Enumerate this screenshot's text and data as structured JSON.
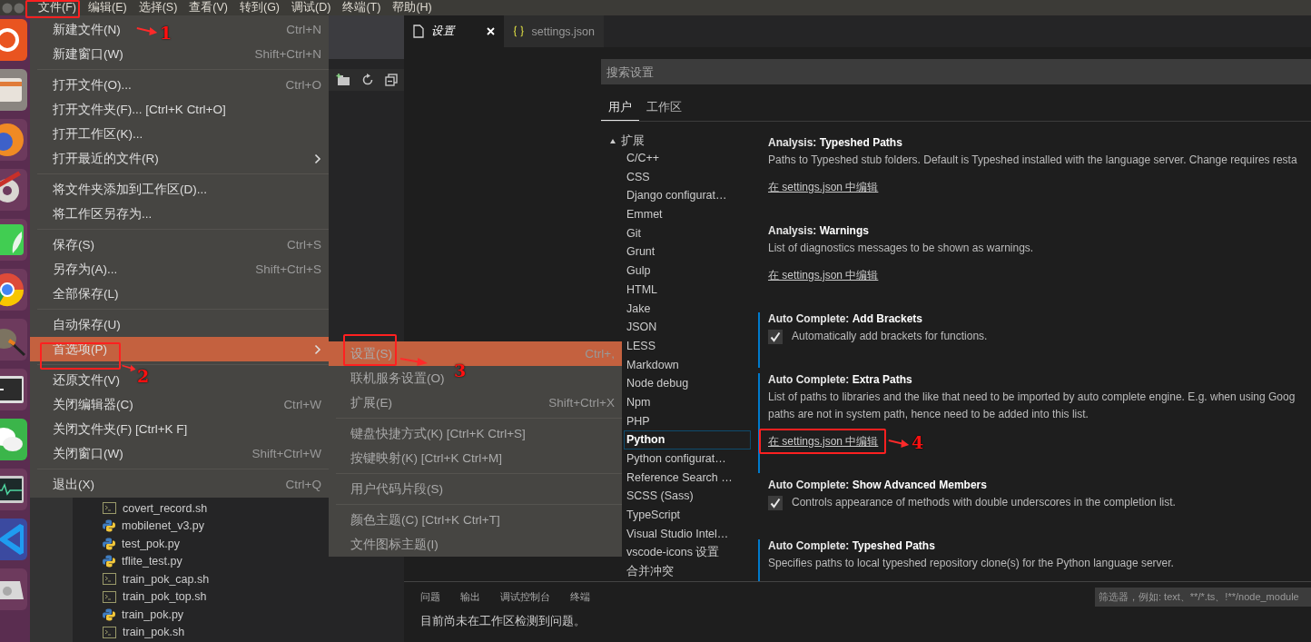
{
  "menubar": [
    {
      "label": "文件(F)"
    },
    {
      "label": "编辑(E)"
    },
    {
      "label": "选择(S)"
    },
    {
      "label": "查看(V)"
    },
    {
      "label": "转到(G)"
    },
    {
      "label": "调试(D)"
    },
    {
      "label": "终端(T)"
    },
    {
      "label": "帮助(H)"
    }
  ],
  "explorer": {
    "files": [
      {
        "name": "covert_record.sh",
        "kind": "shell"
      },
      {
        "name": "mobilenet_v3.py",
        "kind": "python"
      },
      {
        "name": "test_pok.py",
        "kind": "python"
      },
      {
        "name": "tflite_test.py",
        "kind": "python"
      },
      {
        "name": "train_pok_cap.sh",
        "kind": "shell"
      },
      {
        "name": "train_pok_top.sh",
        "kind": "shell"
      },
      {
        "name": "train_pok.py",
        "kind": "python"
      },
      {
        "name": "train_pok.sh",
        "kind": "shell"
      }
    ]
  },
  "editor_tabs": [
    {
      "label": "设置",
      "kind": "page",
      "selected": true
    },
    {
      "label": "settings.json",
      "kind": "json",
      "selected": false
    }
  ],
  "settings": {
    "search": {
      "placeholder": "搜索设置"
    },
    "scope_tabs": [
      {
        "label": "用户",
        "selected": true
      },
      {
        "label": "工作区",
        "selected": false
      }
    ],
    "toc": {
      "label": "扩展",
      "expanded": true,
      "children": [
        {
          "label": "C/C++",
          "selected": false
        },
        {
          "label": "CSS",
          "selected": false
        },
        {
          "label": "Django configurat…",
          "selected": false
        },
        {
          "label": "Emmet",
          "selected": false
        },
        {
          "label": "Git",
          "selected": false
        },
        {
          "label": "Grunt",
          "selected": false
        },
        {
          "label": "Gulp",
          "selected": false
        },
        {
          "label": "HTML",
          "selected": false
        },
        {
          "label": "Jake",
          "selected": false
        },
        {
          "label": "JSON",
          "selected": false
        },
        {
          "label": "LESS",
          "selected": false
        },
        {
          "label": "Markdown",
          "selected": false
        },
        {
          "label": "Node debug",
          "selected": false
        },
        {
          "label": "Npm",
          "selected": false
        },
        {
          "label": "PHP",
          "selected": false
        },
        {
          "label": "Python",
          "selected": true
        },
        {
          "label": "Python configurat…",
          "selected": false
        },
        {
          "label": "Reference Search …",
          "selected": false
        },
        {
          "label": "SCSS (Sass)",
          "selected": false
        },
        {
          "label": "TypeScript",
          "selected": false
        },
        {
          "label": "Visual Studio Intel…",
          "selected": false
        },
        {
          "label": "vscode-icons 设置",
          "selected": false
        },
        {
          "label": "合并冲突",
          "selected": false
        }
      ]
    },
    "items": [
      {
        "kind": "link",
        "modified": false,
        "title": "Analysis: **Typeshed Paths**",
        "description": [
          "Paths to Typeshed stub folders. Default is Typeshed installed with the language server. Change requires resta"
        ],
        "link": "在 settings.json 中编辑"
      },
      {
        "kind": "link",
        "modified": false,
        "title": "Analysis: **Warnings**",
        "description": [
          "List of diagnostics messages to be shown as warnings."
        ],
        "link": "在 settings.json 中编辑"
      },
      {
        "kind": "checkbox",
        "modified": true,
        "title": "Auto Complete: **Add Brackets**",
        "checked": true,
        "description": [
          "Automatically add brackets for functions."
        ]
      },
      {
        "kind": "link",
        "modified": true,
        "title": "Auto Complete: **Extra Paths**",
        "description": [
          "List of paths to libraries and the like that need to be imported by auto complete engine. E.g. when using Goog",
          "paths are not in system path, hence need to be added into this list."
        ],
        "link": "在 settings.json 中编辑"
      },
      {
        "kind": "checkbox",
        "modified": false,
        "title": "Auto Complete: **Show Advanced Members**",
        "checked": true,
        "description": [
          "Controls appearance of methods with double underscores in the completion list."
        ]
      },
      {
        "kind": "link",
        "modified": true,
        "title": "Auto Complete: **Typeshed Paths**",
        "description": [
          "Specifies paths to local typeshed repository clone(s) for the Python language server."
        ]
      }
    ]
  },
  "panel": {
    "tabs": [
      {
        "label": "问题"
      },
      {
        "label": "输出"
      },
      {
        "label": "调试控制台"
      },
      {
        "label": "终端"
      }
    ],
    "filter": {
      "placeholder": "筛选器，例如: text、**/*.ts、!**/node_module"
    },
    "message": "目前尚未在工作区检测到问题。"
  },
  "file_menu": {
    "groups": [
      [
        {
          "label": "新建文件(N)",
          "shortcut": "Ctrl+N",
          "submenu": false,
          "selected": false
        },
        {
          "label": "新建窗口(W)",
          "shortcut": "Shift+Ctrl+N",
          "submenu": false,
          "selected": false
        }
      ],
      [
        {
          "label": "打开文件(O)...",
          "shortcut": "Ctrl+O",
          "submenu": false,
          "selected": false
        },
        {
          "label": "打开文件夹(F)... [Ctrl+K Ctrl+O]",
          "submenu": false,
          "selected": false
        },
        {
          "label": "打开工作区(K)...",
          "submenu": false,
          "selected": false
        },
        {
          "label": "打开最近的文件(R)",
          "submenu": true,
          "selected": false
        }
      ],
      [
        {
          "label": "将文件夹添加到工作区(D)...",
          "submenu": false,
          "selected": false
        },
        {
          "label": "将工作区另存为...",
          "submenu": false,
          "selected": false
        }
      ],
      [
        {
          "label": "保存(S)",
          "shortcut": "Ctrl+S",
          "submenu": false,
          "selected": false
        },
        {
          "label": "另存为(A)...",
          "shortcut": "Shift+Ctrl+S",
          "submenu": false,
          "selected": false
        },
        {
          "label": "全部保存(L)",
          "submenu": false,
          "selected": false
        }
      ],
      [
        {
          "label": "自动保存(U)",
          "submenu": false,
          "selected": false
        },
        {
          "label": "首选项(P)",
          "submenu": true,
          "selected": true
        }
      ],
      [
        {
          "label": "还原文件(V)",
          "submenu": false,
          "selected": false
        },
        {
          "label": "关闭编辑器(C)",
          "shortcut": "Ctrl+W",
          "submenu": false,
          "selected": false
        },
        {
          "label": "关闭文件夹(F) [Ctrl+K F]",
          "submenu": false,
          "selected": false
        },
        {
          "label": "关闭窗口(W)",
          "shortcut": "Shift+Ctrl+W",
          "submenu": false,
          "selected": false
        }
      ],
      [
        {
          "label": "退出(X)",
          "shortcut": "Ctrl+Q",
          "submenu": false,
          "selected": false
        }
      ]
    ]
  },
  "preferences_menu": {
    "groups": [
      [
        {
          "label": "设置(S)",
          "shortcut": "Ctrl+,",
          "selected": true
        },
        {
          "label": "联机服务设置(O)",
          "selected": false
        },
        {
          "label": "扩展(E)",
          "shortcut": "Shift+Ctrl+X",
          "selected": false
        }
      ],
      [
        {
          "label": "键盘快捷方式(K) [Ctrl+K Ctrl+S]",
          "selected": false
        },
        {
          "label": "按键映射(K) [Ctrl+K Ctrl+M]",
          "selected": false
        }
      ],
      [
        {
          "label": "用户代码片段(S)",
          "selected": false
        }
      ],
      [
        {
          "label": "颜色主题(C) [Ctrl+K Ctrl+T]",
          "selected": false
        },
        {
          "label": "文件图标主题(I)",
          "selected": false
        }
      ]
    ]
  },
  "annotations": [
    {
      "number": "1"
    },
    {
      "number": "2"
    },
    {
      "number": "3"
    },
    {
      "number": "4"
    }
  ]
}
